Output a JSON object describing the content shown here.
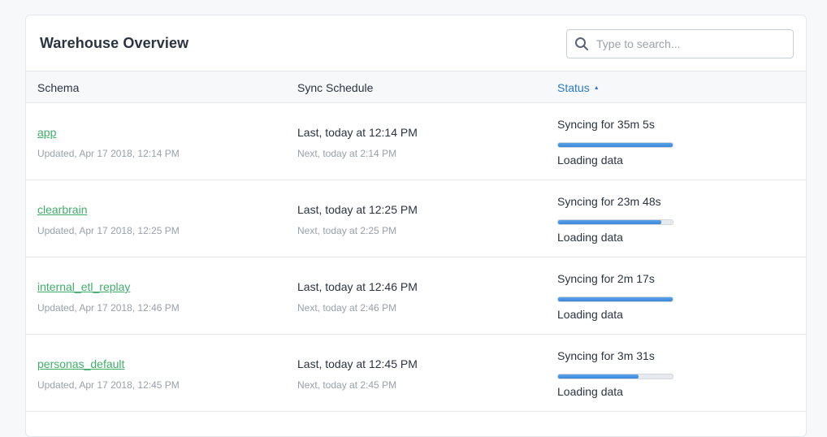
{
  "card": {
    "title": "Warehouse Overview",
    "search": {
      "placeholder": "Type to search...",
      "value": ""
    }
  },
  "table": {
    "columns": {
      "schema": "Schema",
      "sync": "Sync Schedule",
      "status": "Status"
    },
    "sort_indicator": "▲",
    "rows": [
      {
        "name": "app",
        "updated": "Updated, Apr 17 2018, 12:14 PM",
        "last": "Last, today at 12:14 PM",
        "next": "Next, today at 2:14 PM",
        "status": "Syncing for 35m 5s",
        "progress": 1.0,
        "sub": "Loading data"
      },
      {
        "name": "clearbrain",
        "updated": "Updated, Apr 17 2018, 12:25 PM",
        "last": "Last, today at 12:25 PM",
        "next": "Next, today at 2:25 PM",
        "status": "Syncing for 23m 48s",
        "progress": 0.9,
        "sub": "Loading data"
      },
      {
        "name": "internal_etl_replay",
        "updated": "Updated, Apr 17 2018, 12:46 PM",
        "last": "Last, today at 12:46 PM",
        "next": "Next, today at 2:46 PM",
        "status": "Syncing for 2m 17s",
        "progress": 1.0,
        "sub": "Loading data"
      },
      {
        "name": "personas_default",
        "updated": "Updated, Apr 17 2018, 12:45 PM",
        "last": "Last, today at 12:45 PM",
        "next": "Next, today at 2:45 PM",
        "status": "Syncing for 3m 31s",
        "progress": 0.7,
        "sub": "Loading data"
      }
    ]
  },
  "colors": {
    "link": "#3fae6a",
    "accent": "#2b78c4",
    "progress": "#3b86d8"
  }
}
